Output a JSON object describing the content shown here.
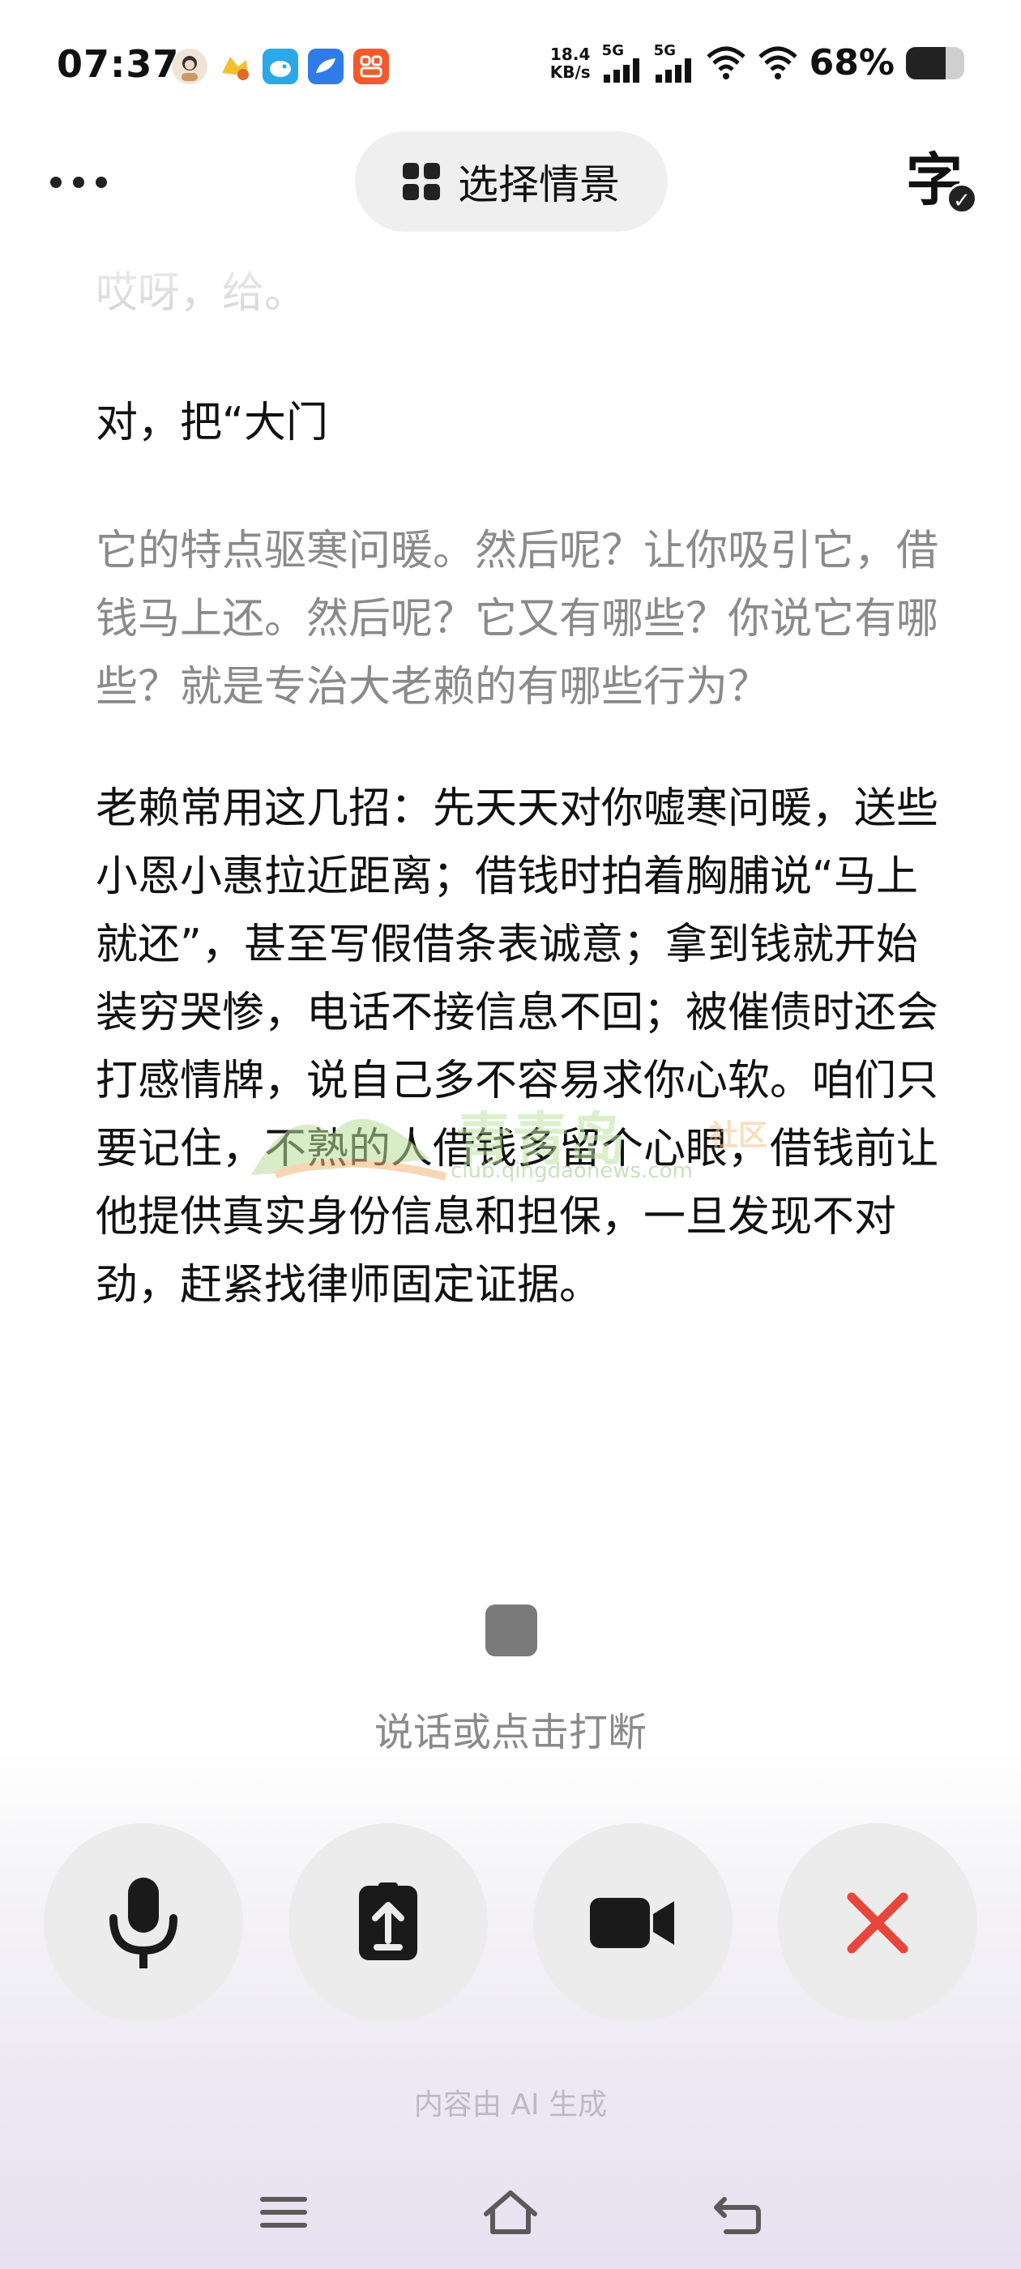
{
  "status_bar": {
    "time": "07:37",
    "net_speed_value": "18.4",
    "net_speed_unit": "KB/s",
    "signal_1_label": "5G",
    "signal_2_label": "5G",
    "battery_text": "68%",
    "battery_level": 0.68,
    "notification_icons": [
      "avatar-icon",
      "game-icon",
      "bird-app-icon",
      "cloud-app-icon",
      "orange-app-icon"
    ]
  },
  "top_bar": {
    "scene_button_label": "选择情景",
    "subtitle_toggle_char": "字"
  },
  "transcript": [
    {
      "style": "faded",
      "text": "哎呀，给。"
    },
    {
      "style": "dark",
      "text": "对，把“大门"
    },
    {
      "style": "grey",
      "text": "它的特点驱寒问暖。然后呢？让你吸引它，借钱马上还。然后呢？它又有哪些？你说它有哪些？就是专治大老赖的有哪些行为？"
    },
    {
      "style": "dark",
      "text": "老赖常用这几招：先天天对你嘘寒问暖，送些小恩小惠拉近距离；借钱时拍着胸脯说“马上就还”，甚至写假借条表诚意；拿到钱就开始装穷哭惨，电话不接信息不回；被催债时还会打感情牌，说自己多不容易求你心软。咱们只要记住，不熟的人借钱多留个心眼，借钱前让他提供真实身份信息和担保，一旦发现不对劲，赶紧找律师固定证据。"
    }
  ],
  "watermark": {
    "title": "青青岛",
    "subtitle": "社区",
    "url": "club.qingdaonews.com"
  },
  "interrupt_hint": "说话或点击打断",
  "controls": [
    "microphone-icon",
    "share-screen-icon",
    "video-camera-icon",
    "close-icon"
  ],
  "colors": {
    "close_red": "#e8453c",
    "icon_dark": "#1a1a1a"
  },
  "footer_note": "内容由 AI 生成"
}
